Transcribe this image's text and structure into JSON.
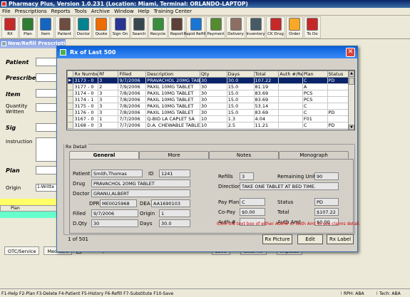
{
  "app": {
    "title": "Pharmacy Plus, Version 1.0.231 (Location: Miami, Terminal: ORLANDO-LAPTOP)"
  },
  "menu": [
    "File",
    "Prescriptions",
    "Reports",
    "Tools",
    "Archive",
    "Window",
    "Help",
    "Training Center"
  ],
  "toolbar": [
    {
      "label": "RX",
      "icon": "rx-icon",
      "color": "#c62828"
    },
    {
      "label": "Plan",
      "icon": "plan-icon",
      "color": "#2e7d32"
    },
    {
      "label": "Item",
      "icon": "item-icon",
      "color": "#1565c0"
    },
    {
      "label": "Patient",
      "icon": "patient-icon",
      "color": "#6d4c41"
    },
    {
      "label": "Doctor",
      "icon": "doctor-icon",
      "color": "#00838f"
    },
    {
      "label": "Quote",
      "icon": "quote-icon",
      "color": "#ef6c00"
    },
    {
      "label": "Sign On",
      "icon": "sign-on-icon",
      "color": "#283593"
    },
    {
      "label": "Search",
      "icon": "search-icon",
      "color": "#37474f"
    },
    {
      "label": "Recycle",
      "icon": "recycle-icon",
      "color": "#388e3c"
    },
    {
      "label": "Report",
      "icon": "report-icon",
      "color": "#5d4037"
    },
    {
      "label": "Rapid Refills",
      "icon": "rapid-refills-icon",
      "color": "#1976d2"
    },
    {
      "label": "Payment",
      "icon": "payment-icon",
      "color": "#558b2f"
    },
    {
      "label": "Delivery",
      "icon": "delivery-icon",
      "color": "#8d6e63"
    },
    {
      "label": "Inventory",
      "icon": "inventory-icon",
      "color": "#455a64"
    },
    {
      "label": "CK Drug",
      "icon": "check-drug-icon",
      "color": "#c62828"
    },
    {
      "label": "Order",
      "icon": "order-icon",
      "color": "#f9a825"
    },
    {
      "label": "To Do",
      "icon": "todo-icon",
      "color": "#c62828"
    }
  ],
  "bg_window": {
    "title": "New/Refill Prescription",
    "labels": {
      "patient": "Patient",
      "prescriber": "Prescriber",
      "item": "Item",
      "quantity": "Quantity Written",
      "sig": "Sig",
      "instruction": "Instruction",
      "plan": "Plan",
      "origin": "Origin"
    },
    "origin_value": "1-Writte",
    "plan_col": "Plan",
    "buttons": {
      "otc": "OTC/Service",
      "medicare": "Medicare",
      "take_rx_picture": "Take Rx picture",
      "save": "Save",
      "clear_all": "Clear All",
      "implode": "Implode"
    }
  },
  "status_bar": {
    "keys": "F1-Help  F2-Plan  F3-Delete  F4-Patient  F5-History  F6-Refill  F7-Substitute  F10-Save",
    "rph": "RPH: ABA",
    "tech": "Tech: ABA"
  },
  "dialog": {
    "title": "Rx of Last 500",
    "columns": [
      "Rx Number",
      "Rf",
      "Filled",
      "Description",
      "Qty",
      "Days",
      "Total",
      "Auth #/Ref",
      "Plan",
      "Status"
    ],
    "rows": [
      [
        "3173 - 0",
        "3",
        "9/7/2006",
        "PRAVACHOL 20MG TABLET",
        "30",
        "30.0",
        "107.22",
        "",
        "C",
        "PD"
      ],
      [
        "3177 - 0",
        "2",
        "7/9/2006",
        "PAXIL 10MG TABLET",
        "30",
        "15.0",
        "81.19",
        "",
        "A",
        ""
      ],
      [
        "3174 - 0",
        "3",
        "7/8/2006",
        "PAXIL 10MG TABLET",
        "30",
        "15.0",
        "83.69",
        "",
        "PCS",
        ""
      ],
      [
        "3174 - 1",
        "3",
        "7/8/2006",
        "PAXIL 10MG TABLET",
        "30",
        "15.0",
        "83.69",
        "",
        "PCS",
        ""
      ],
      [
        "3175 - 0",
        "3",
        "7/8/2006",
        "PAXIL 10MG TABLET",
        "30",
        "15.0",
        "53.14",
        "",
        "C",
        ""
      ],
      [
        "3176 - 0",
        "3",
        "7/8/2006",
        "PAXIL 10MG TABLET",
        "30",
        "15.0",
        "83.69",
        "",
        "C",
        "PD"
      ],
      [
        "3167 - 0",
        "1",
        "7/7/2006",
        "Q-BID LA CAPLET SA",
        "10",
        "1.3",
        "4.04",
        "",
        "F01",
        ""
      ],
      [
        "3168 - 0",
        "3",
        "7/7/2006",
        "D.A. CHEWABLE TABLET",
        "10",
        "2.5",
        "11.21",
        "",
        "C",
        "PD"
      ]
    ],
    "detail_label": "Rx Detail",
    "tabs": [
      "General",
      "More",
      "Notes",
      "Monograph"
    ],
    "general": {
      "patient_label": "Patient",
      "patient": "Smith,Thomas",
      "id_label": "ID",
      "id": "1241",
      "drug_label": "Drug",
      "drug": "PRAVACHOL 20MG TABLET",
      "doctor_label": "Doctor",
      "doctor": "GRANU,ALBERT",
      "dpr_label": "DPR",
      "dpr": "ME0025968",
      "dea_label": "DEA",
      "dea": "AA1690103",
      "filled_label": "Filled",
      "filled": "9/7/2006",
      "origin_label": "Origin",
      "origin": "1",
      "dqty_label": "D.Qty",
      "dqty": "30",
      "days_label": "Days",
      "days": "30.0",
      "refills_label": "Refills",
      "refills": "3",
      "remaining_label": "Remaining Units",
      "remaining": "90",
      "directions_label": "Directions",
      "directions": "TAKE ONE TABLET AT BED TIME.",
      "payplan_label": "Pay Plan",
      "payplan": "C",
      "status_label": "Status",
      "status": "PD",
      "copay_label": "Co-Pay",
      "copay": "$0.00",
      "total_label": "Total",
      "total": "$107.22",
      "auth_label": "Auth #",
      "auth": "",
      "authamt_label": "Auth Amt",
      "authamt": "$0.00",
      "note": "Click the text box of either Auth# or Auth Amt to see claims detail."
    },
    "count": "1 of 501",
    "buttons": {
      "picture": "Rx Picture",
      "edit": "Edit",
      "label": "Rx Label"
    }
  }
}
